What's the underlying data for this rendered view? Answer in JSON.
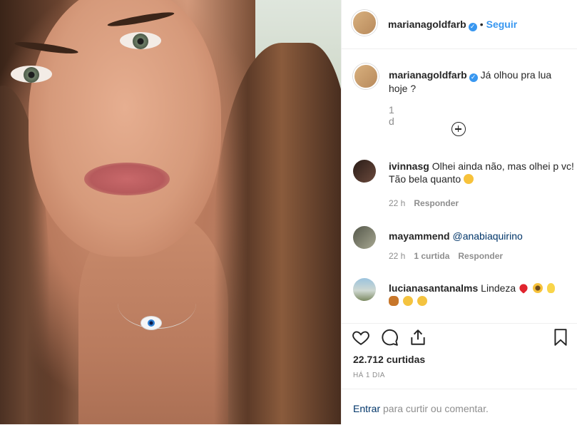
{
  "post": {
    "author": "marianagoldfarb",
    "follow_label": "Seguir",
    "separator": "•",
    "verified_glyph": "✓",
    "caption": "Já olhou pra lua hoje ?",
    "caption_time": "1 d"
  },
  "comments": [
    {
      "user": "ivinnasg",
      "text": "Olhei ainda não, mas olhei p vc! Tão bela quanto",
      "emojis": [
        "heart-eyes-emoji"
      ],
      "time": "22 h",
      "likes": "",
      "reply": "Responder"
    },
    {
      "user": "mayammend",
      "text": "",
      "mention": "@anabiaquirino",
      "time": "22 h",
      "likes": "1 curtida",
      "reply": "Responder"
    },
    {
      "user": "lucianasantanalms",
      "text": "Lindeza",
      "emojis": [
        "red-heart-emoji",
        "sunflower-emoji",
        "light-bulb-emoji",
        "butterfly-emoji",
        "clapping-hands-emoji",
        "clapping-hands-emoji"
      ]
    }
  ],
  "actions": {
    "likes": "22.712 curtidas",
    "time_ago": "HÁ 1 DIA",
    "icons": [
      "heart-icon",
      "comment-icon",
      "share-icon",
      "bookmark-icon"
    ]
  },
  "login": {
    "enter": "Entrar",
    "rest": "para curtir ou comentar."
  },
  "colors": {
    "link": "#3897f0",
    "muted": "#8e8e8e",
    "text": "#262626",
    "mention": "#003569"
  }
}
